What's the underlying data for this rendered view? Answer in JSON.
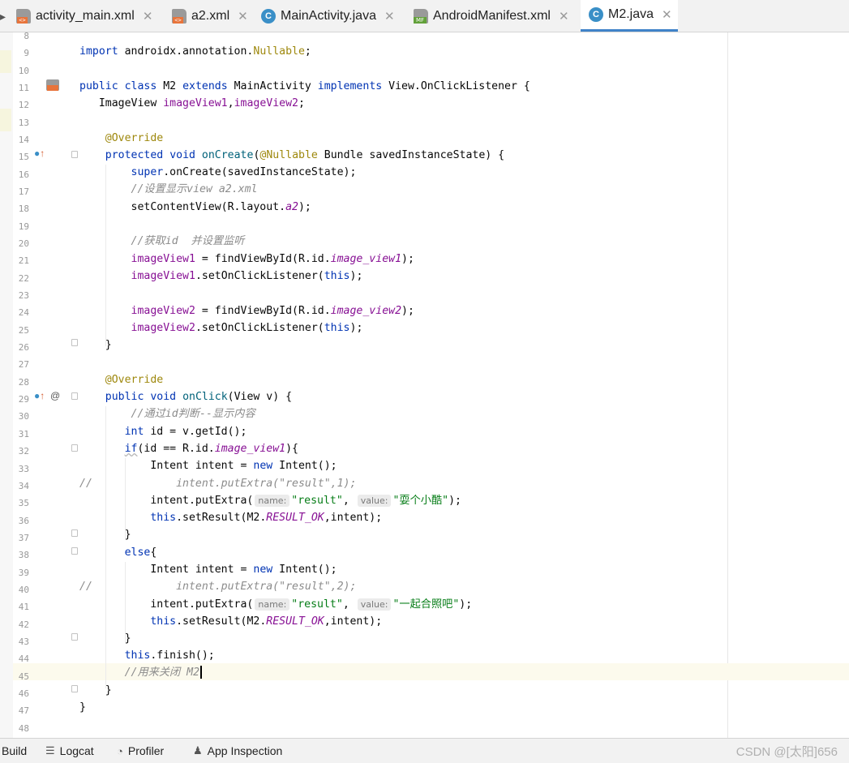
{
  "tabs": [
    {
      "label": "activity_main.xml",
      "icon": "xml-file-icon",
      "active": false
    },
    {
      "label": "a2.xml",
      "icon": "xml-file-icon",
      "active": false
    },
    {
      "label": "MainActivity.java",
      "icon": "java-class-icon",
      "active": false
    },
    {
      "label": "AndroidManifest.xml",
      "icon": "manifest-file-icon",
      "active": false
    },
    {
      "label": "M2.java",
      "icon": "java-class-icon",
      "active": true
    }
  ],
  "close_glyph": "✕",
  "line_numbers": [
    "8",
    "9",
    "10",
    "11",
    "12",
    "13",
    "14",
    "15",
    "16",
    "17",
    "18",
    "19",
    "20",
    "21",
    "22",
    "23",
    "24",
    "25",
    "26",
    "27",
    "28",
    "29",
    "30",
    "31",
    "32",
    "33",
    "34",
    "35",
    "36",
    "37",
    "38",
    "39",
    "40",
    "41",
    "42",
    "43",
    "44",
    "45",
    "46",
    "47",
    "48"
  ],
  "code": {
    "l9": [
      "import",
      " androidx.annotation.",
      "Nullable",
      ";"
    ],
    "l11": [
      "public",
      " ",
      "class",
      " M2 ",
      "extends",
      " MainActivity ",
      "implements",
      " View.OnClickListener {"
    ],
    "l12": [
      "   ImageView ",
      "imageView1",
      ",",
      "imageView2",
      ";"
    ],
    "l14": [
      "    @Override"
    ],
    "l15": [
      "    ",
      "protected",
      " ",
      "void",
      " ",
      "onCreate",
      "(",
      "@Nullable",
      " Bundle savedInstanceState) {"
    ],
    "l16": [
      "        ",
      "super",
      ".onCreate(savedInstanceState);"
    ],
    "l17": [
      "        //设置显示view a2.xml"
    ],
    "l18": [
      "        setContentView(R.layout.",
      "a2",
      ");"
    ],
    "l20": [
      "        //获取id  并设置监听"
    ],
    "l21": [
      "        ",
      "imageView1",
      " = findViewById(R.id.",
      "image_view1",
      ");"
    ],
    "l22": [
      "        ",
      "imageView1",
      ".setOnClickListener(",
      "this",
      ");"
    ],
    "l24": [
      "        ",
      "imageView2",
      " = findViewById(R.id.",
      "image_view2",
      ");"
    ],
    "l25": [
      "        ",
      "imageView2",
      ".setOnClickListener(",
      "this",
      ");"
    ],
    "l26": [
      "    }"
    ],
    "l28": [
      "    @Override"
    ],
    "l29": [
      "    ",
      "public",
      " ",
      "void",
      " ",
      "onClick",
      "(View v) {"
    ],
    "l30": [
      "        //通过id判断--显示内容"
    ],
    "l31": [
      "       ",
      "int",
      " id = v.getId();"
    ],
    "l32": [
      "       ",
      "if",
      "(id == R.id.",
      "image_view1",
      "){"
    ],
    "l33": [
      "           Intent intent = ",
      "new",
      " Intent();"
    ],
    "l34": [
      "//             intent.putExtra(\"result\",1);"
    ],
    "l35": [
      "           intent.putExtra(",
      "name:",
      "\"result\"",
      ", ",
      "value:",
      "\"耍个小酷\u0001\"",
      ");"
    ],
    "l36": [
      "           ",
      "this",
      ".setResult(M2.",
      "RESULT_OK",
      ",intent);"
    ],
    "l37": [
      "       }"
    ],
    "l38": [
      "       ",
      "else",
      "{"
    ],
    "l39": [
      "           Intent intent = ",
      "new",
      " Intent();"
    ],
    "l40": [
      "//             intent.putExtra(\"result\",2);"
    ],
    "l41": [
      "           intent.putExtra(",
      "name:",
      "\"result\"",
      ", ",
      "value:",
      "\"一起合照吧\"",
      ");"
    ],
    "l42": [
      "           ",
      "this",
      ".setResult(M2.",
      "RESULT_OK",
      ",intent);"
    ],
    "l43": [
      "       }"
    ],
    "l44": [
      "       ",
      "this",
      ".finish();"
    ],
    "l45": [
      "       //用来关闭 M2"
    ],
    "l46": [
      "    }"
    ],
    "l47": [
      "}"
    ]
  },
  "gutter_icons": {
    "at": "@"
  },
  "bottom_bar": {
    "build": "Build",
    "logcat": "Logcat",
    "profiler": "Profiler",
    "app_inspection": "App Inspection",
    "watermark": "CSDN @[太阳]656"
  },
  "colors": {
    "keyword": "#0033b3",
    "annotation": "#9e880d",
    "field": "#871094",
    "string": "#067d17",
    "comment": "#8c8c8c",
    "accent": "#4083c9"
  }
}
